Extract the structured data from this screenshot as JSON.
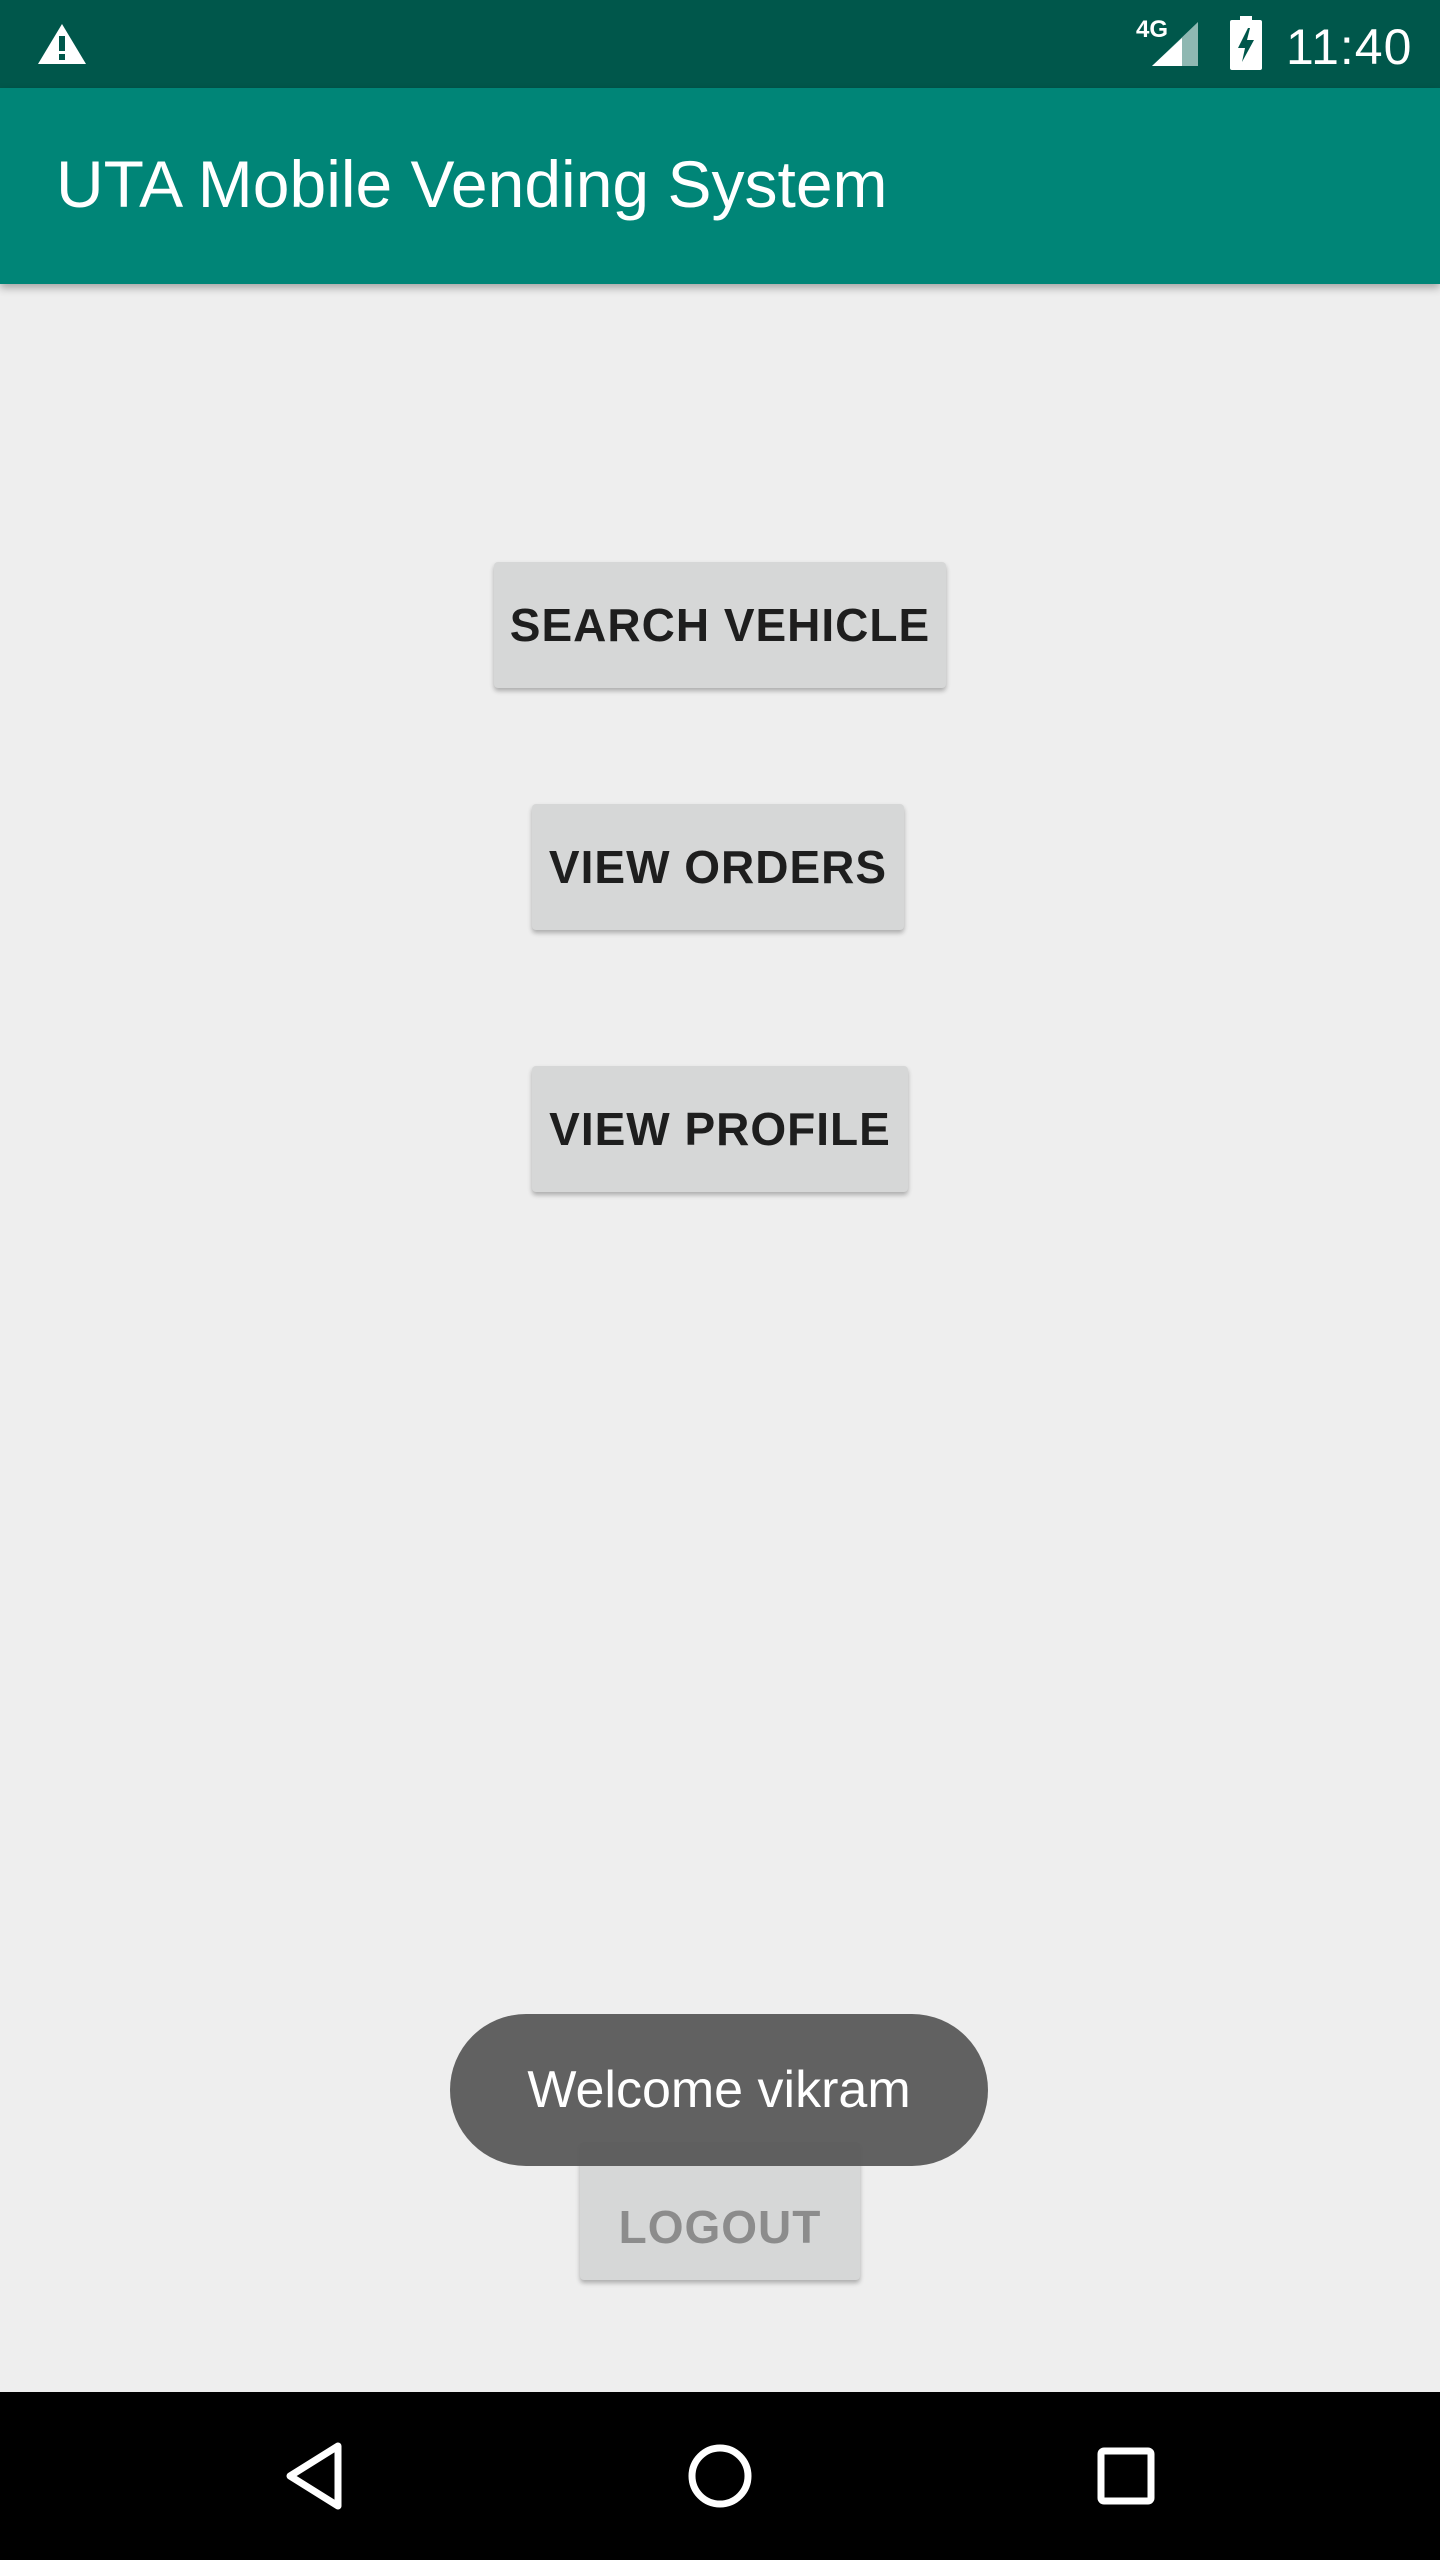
{
  "status_bar": {
    "network": "4G",
    "time": "11:40",
    "icons": [
      "warning-icon",
      "signal-icon",
      "battery-charging-icon"
    ]
  },
  "app_bar": {
    "title": "UTA Mobile Vending System"
  },
  "buttons": {
    "search_vehicle": "SEARCH VEHICLE",
    "view_orders": "VIEW ORDERS",
    "view_profile": "VIEW PROFILE",
    "logout": "LOGOUT"
  },
  "toast": {
    "message": "Welcome vikram"
  },
  "nav_bar": {
    "icons": [
      "back-icon",
      "home-icon",
      "recent-apps-icon"
    ]
  },
  "colors": {
    "status_bar": "#00574b",
    "app_bar": "#008577",
    "background": "#eeeeee",
    "button": "#d6d7d7",
    "toast": "#555555"
  }
}
